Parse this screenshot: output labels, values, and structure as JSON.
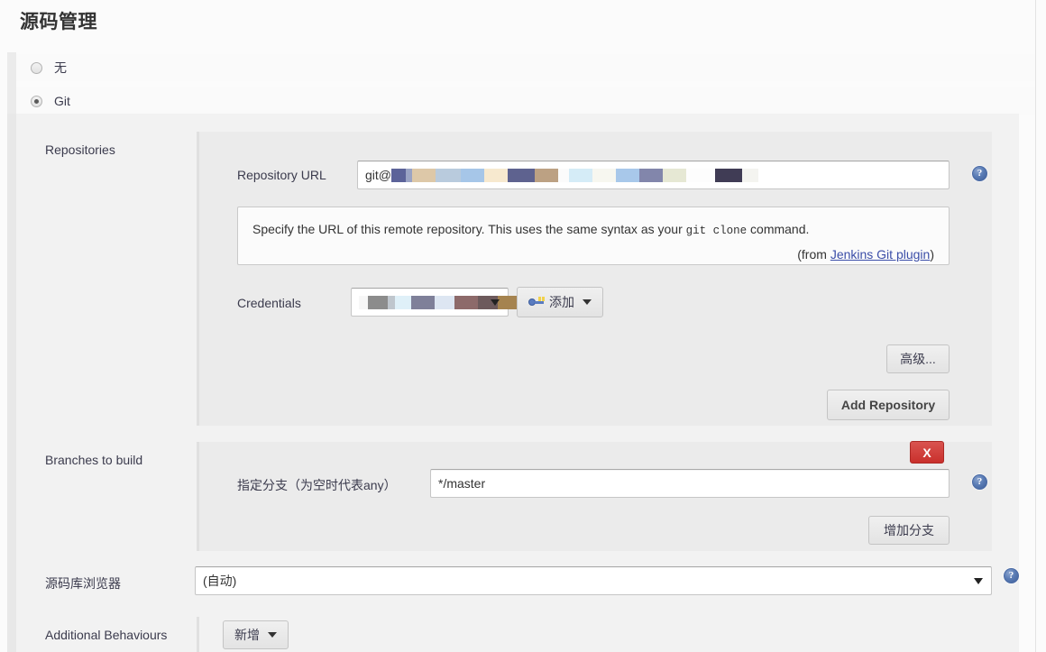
{
  "page": {
    "title": "源码管理"
  },
  "scm_options": [
    {
      "label": "无",
      "checked": false
    },
    {
      "label": "Git",
      "checked": true
    }
  ],
  "repositories": {
    "row_label": "Repositories",
    "url_label": "Repository URL",
    "url_prefix": "git@",
    "url_redacted": true,
    "url_blocks": [
      {
        "w": 16,
        "color": "#5c6399"
      },
      {
        "w": 7,
        "color": "#9aa3c4"
      },
      {
        "w": 26,
        "color": "#ddc8a8"
      },
      {
        "w": 28,
        "color": "#b9cbdd"
      },
      {
        "w": 26,
        "color": "#a6c6e8"
      },
      {
        "w": 26,
        "color": "#f7e9cf"
      },
      {
        "w": 30,
        "color": "#5e628f"
      },
      {
        "w": 26,
        "color": "#bca183"
      },
      {
        "w": 12,
        "color": "#fbfbfb"
      },
      {
        "w": 26,
        "color": "#d5ecf7"
      },
      {
        "w": 26,
        "color": "#f7f7f0"
      },
      {
        "w": 26,
        "color": "#a8c8ea"
      },
      {
        "w": 26,
        "color": "#8286ab"
      },
      {
        "w": 26,
        "color": "#e6e8d4"
      },
      {
        "w": 32,
        "color": "#fdfdfd"
      },
      {
        "w": 30,
        "color": "#403c55"
      },
      {
        "w": 18,
        "color": "#f4f4f0"
      }
    ],
    "help_text_1": "Specify the URL of this remote repository. This uses the same syntax as your ",
    "help_mono": "git clone",
    "help_text_2": " command.",
    "help_from_prefix": "(from ",
    "help_link": "Jenkins Git plugin",
    "help_from_suffix": ")",
    "credentials_label": "Credentials",
    "credentials_redacted": true,
    "credentials_blocks": [
      {
        "w": 10,
        "color": "#f7f7f7"
      },
      {
        "w": 22,
        "color": "#8c8c8c"
      },
      {
        "w": 8,
        "color": "#bfc6cd"
      },
      {
        "w": 18,
        "color": "#dff0f8"
      },
      {
        "w": 26,
        "color": "#7f8099"
      },
      {
        "w": 22,
        "color": "#dde6f2"
      },
      {
        "w": 26,
        "color": "#8d6a6a"
      },
      {
        "w": 22,
        "color": "#6d5a5c"
      },
      {
        "w": 22,
        "color": "#a5834f"
      }
    ],
    "add_credentials_label": "添加",
    "advanced_label": "高级...",
    "add_repository_label": "Add Repository"
  },
  "branches": {
    "row_label": "Branches to build",
    "delete_label": "X",
    "spec_label": "指定分支（为空时代表any）",
    "spec_value": "*/master",
    "add_branch_label": "增加分支"
  },
  "browser": {
    "row_label": "源码库浏览器",
    "value": "(自动)"
  },
  "additional": {
    "row_label": "Additional Behaviours",
    "add_label": "新增"
  },
  "icons": {
    "help": "?"
  }
}
